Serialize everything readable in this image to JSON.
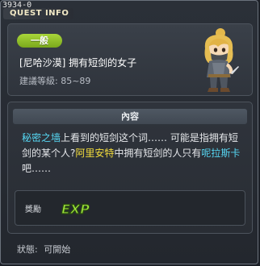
{
  "window": {
    "quest_id": "3934-0",
    "title": "QUEST INFO"
  },
  "quest": {
    "category": "一般",
    "name": "[尼哈沙漠] 拥有短剑的女子",
    "level_label": "建議等級:",
    "level_range": "85~89"
  },
  "content": {
    "header": "內容",
    "segments": [
      {
        "text": "秘密之墙",
        "style": "cyan"
      },
      {
        "text": "上看到的短剑这个词…… 可能是指拥有短剑的某个人?",
        "style": "normal"
      },
      {
        "text": "阿里安特",
        "style": "yellow"
      },
      {
        "text": "中拥有短剑的人只有",
        "style": "normal"
      },
      {
        "text": "呢拉斯卡",
        "style": "cyan"
      },
      {
        "text": "吧……",
        "style": "normal"
      }
    ]
  },
  "reward": {
    "label": "獎勵",
    "icon": "exp-icon",
    "icon_text": "EXP"
  },
  "status": {
    "label": "狀態:",
    "value": "可開始"
  },
  "colors": {
    "highlight_cyan": "#56d6f2",
    "highlight_yellow": "#f3dd3c",
    "category_green": "#8fc12a"
  }
}
